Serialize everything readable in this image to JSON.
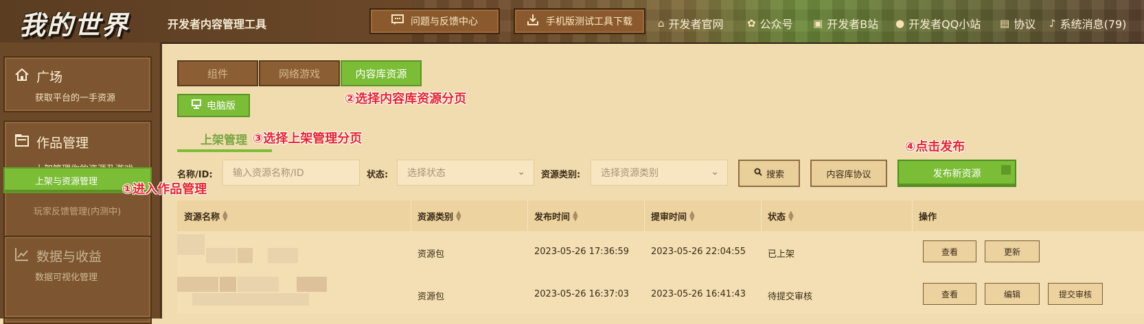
{
  "header": {
    "logo": "我的世界",
    "app_title": "开发者内容管理工具",
    "buttons": [
      {
        "label": "问题与反馈中心",
        "icon": "chat-icon"
      },
      {
        "label": "手机版测试工具下载",
        "icon": "download-icon"
      }
    ],
    "links": [
      {
        "label": "开发者官网",
        "icon": "house-icon"
      },
      {
        "label": "公众号",
        "icon": "wechat-icon"
      },
      {
        "label": "开发者B站",
        "icon": "bilibili-icon"
      },
      {
        "label": "开发者QQ小站",
        "icon": "qq-icon"
      },
      {
        "label": "协议",
        "icon": "document-icon"
      },
      {
        "label": "系统消息(79)",
        "icon": "bell-icon"
      }
    ]
  },
  "sidebar": {
    "sections": [
      {
        "title": "广场",
        "subtitle": "获取平台的一手资源",
        "icon": "home-icon"
      },
      {
        "title": "作品管理",
        "subtitle": "上架管理你的资源及游戏",
        "icon": "folder-icon"
      },
      {
        "title": "数据与收益",
        "subtitle": "数据可视化管理",
        "icon": "chart-icon"
      }
    ],
    "sub_items": [
      {
        "label": "上架与资源管理"
      },
      {
        "label": "玩家反馈管理(内测中)"
      }
    ]
  },
  "tabs": [
    "组件",
    "网络游戏",
    "内容库资源"
  ],
  "pc_button": "电脑版",
  "subtab": "上架管理",
  "filters": {
    "name_label": "名称/ID:",
    "name_placeholder": "输入资源名称/ID",
    "status_label": "状态:",
    "status_placeholder": "选择状态",
    "category_label": "资源类别:",
    "category_placeholder": "选择资源类别",
    "search": "搜索",
    "protocol": "内容库协议",
    "publish": "发布新资源"
  },
  "annotations": {
    "a1": "①进入作品管理",
    "a2": "②选择内容库资源分页",
    "a3": "③选择上架管理分页",
    "a4": "④点击发布"
  },
  "table": {
    "headers": [
      "资源名称",
      "资源类别",
      "发布时间",
      "提审时间",
      "状态",
      "操作"
    ],
    "rows": [
      {
        "category": "资源包",
        "publish_time": "2023-05-26 17:36:59",
        "review_time": "2023-05-26 22:04:55",
        "status": "已上架",
        "actions": [
          "查看",
          "更新"
        ]
      },
      {
        "category": "资源包",
        "publish_time": "2023-05-26 16:37:03",
        "review_time": "2023-05-26 16:41:43",
        "status": "待提交审核",
        "actions": [
          "查看",
          "编辑",
          "提交审核"
        ]
      }
    ]
  },
  "colors": {
    "accent_green": "#7bbd36",
    "brown": "#6a4828",
    "annotation_red": "#e8232c"
  }
}
